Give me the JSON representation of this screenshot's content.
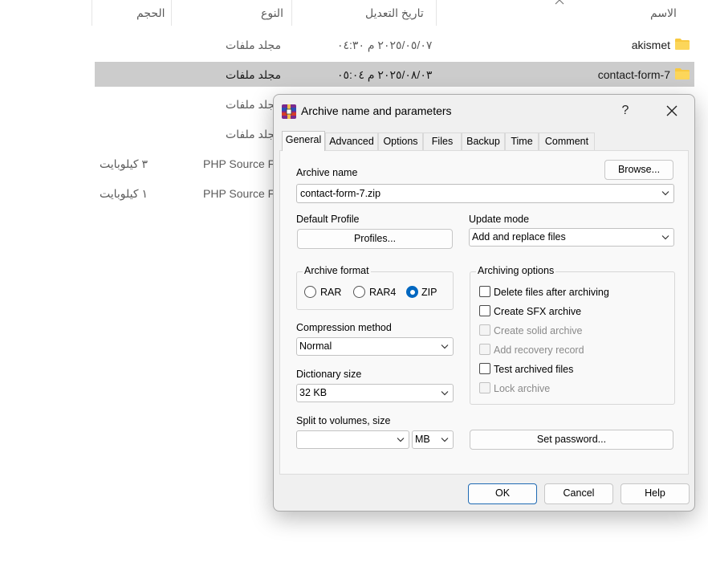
{
  "explorer": {
    "columns": {
      "name": "الاسم",
      "modified": "تاريخ التعديل",
      "type": "النوع",
      "size": "الحجم"
    },
    "rows": [
      {
        "name": "akismet",
        "modified": "٢٠٢٥/٠٥/٠٧ م ٠٤:٣٠",
        "type": "مجلد ملفات",
        "size": ""
      },
      {
        "name": "contact-form-7",
        "modified": "٢٠٢٥/٠٨/٠٣ م ٠٥:٠٤",
        "type": "مجلد ملفات",
        "size": ""
      },
      {
        "name": "",
        "modified": "",
        "type": "مجلد ملفات",
        "size": ""
      },
      {
        "name": "",
        "modified": "",
        "type": "مجلد ملفات",
        "size": ""
      },
      {
        "name": "",
        "modified": "",
        "type": "PHP Source F",
        "size": "٣ كيلوبايت"
      },
      {
        "name": "",
        "modified": "",
        "type": "PHP Source F",
        "size": "١ كيلوبايت"
      }
    ]
  },
  "dialog": {
    "title": "Archive name and parameters",
    "help_glyph": "?",
    "tabs": [
      "General",
      "Advanced",
      "Options",
      "Files",
      "Backup",
      "Time",
      "Comment"
    ],
    "archive_name_label": "Archive name",
    "browse_button": "Browse...",
    "archive_name_value": "contact-form-7.zip",
    "default_profile_label": "Default Profile",
    "profiles_button": "Profiles...",
    "update_mode_label": "Update mode",
    "update_mode_value": "Add and replace files",
    "archive_format": {
      "title": "Archive format",
      "options": [
        "RAR",
        "RAR4",
        "ZIP"
      ],
      "selected": "ZIP"
    },
    "compression_method_label": "Compression method",
    "compression_method_value": "Normal",
    "dictionary_size_label": "Dictionary size",
    "dictionary_size_value": "32 KB",
    "split_label": "Split to volumes, size",
    "split_value": "",
    "split_unit": "MB",
    "archiving_options": {
      "title": "Archiving options",
      "items": [
        {
          "label": "Delete files after archiving",
          "checked": false,
          "enabled": true
        },
        {
          "label": "Create SFX archive",
          "checked": false,
          "enabled": true
        },
        {
          "label": "Create solid archive",
          "checked": false,
          "enabled": false
        },
        {
          "label": "Add recovery record",
          "checked": false,
          "enabled": false
        },
        {
          "label": "Test archived files",
          "checked": false,
          "enabled": true
        },
        {
          "label": "Lock archive",
          "checked": false,
          "enabled": false
        }
      ]
    },
    "set_password_button": "Set password...",
    "ok_button": "OK",
    "cancel_button": "Cancel",
    "help_button": "Help"
  },
  "icons": {
    "folder": "folder-icon",
    "winrar": "winrar-icon",
    "close": "close-icon",
    "chevron": "chevron-down-icon",
    "sort": "sort-caret-icon"
  },
  "colors": {
    "accent": "#0067c0",
    "folder_yellow": "#f8c940",
    "selection": "#cccccc"
  }
}
